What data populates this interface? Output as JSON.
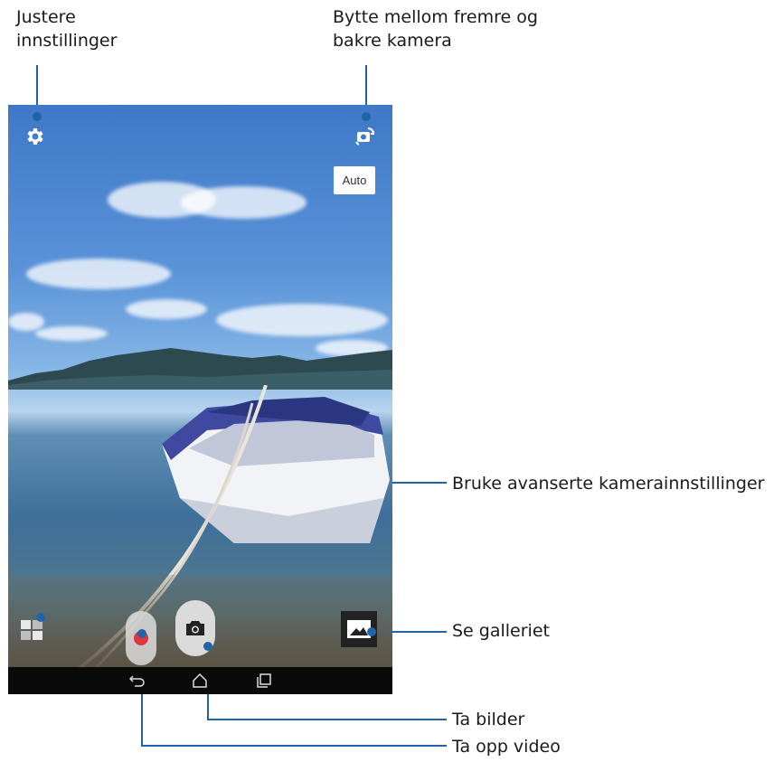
{
  "callouts": {
    "settings": "Justere innstillinger",
    "switch_camera": "Bytte mellom fremre og bakre kamera",
    "advanced": "Bruke avanserte kamerainnstillinger",
    "gallery": "Se galleriet",
    "take_photo": "Ta bilder",
    "record_video": "Ta opp video"
  },
  "camera": {
    "mode_button": "Auto"
  },
  "icons": {
    "settings": "gear-icon",
    "switch_camera": "camera-switch-icon",
    "advanced": "grid-icon",
    "record": "record-icon",
    "shutter": "camera-icon",
    "gallery": "gallery-icon",
    "back": "back-icon",
    "home": "home-icon",
    "recent": "recent-apps-icon"
  },
  "colors": {
    "annotation": "#1f64a8",
    "record": "#e0363c"
  }
}
